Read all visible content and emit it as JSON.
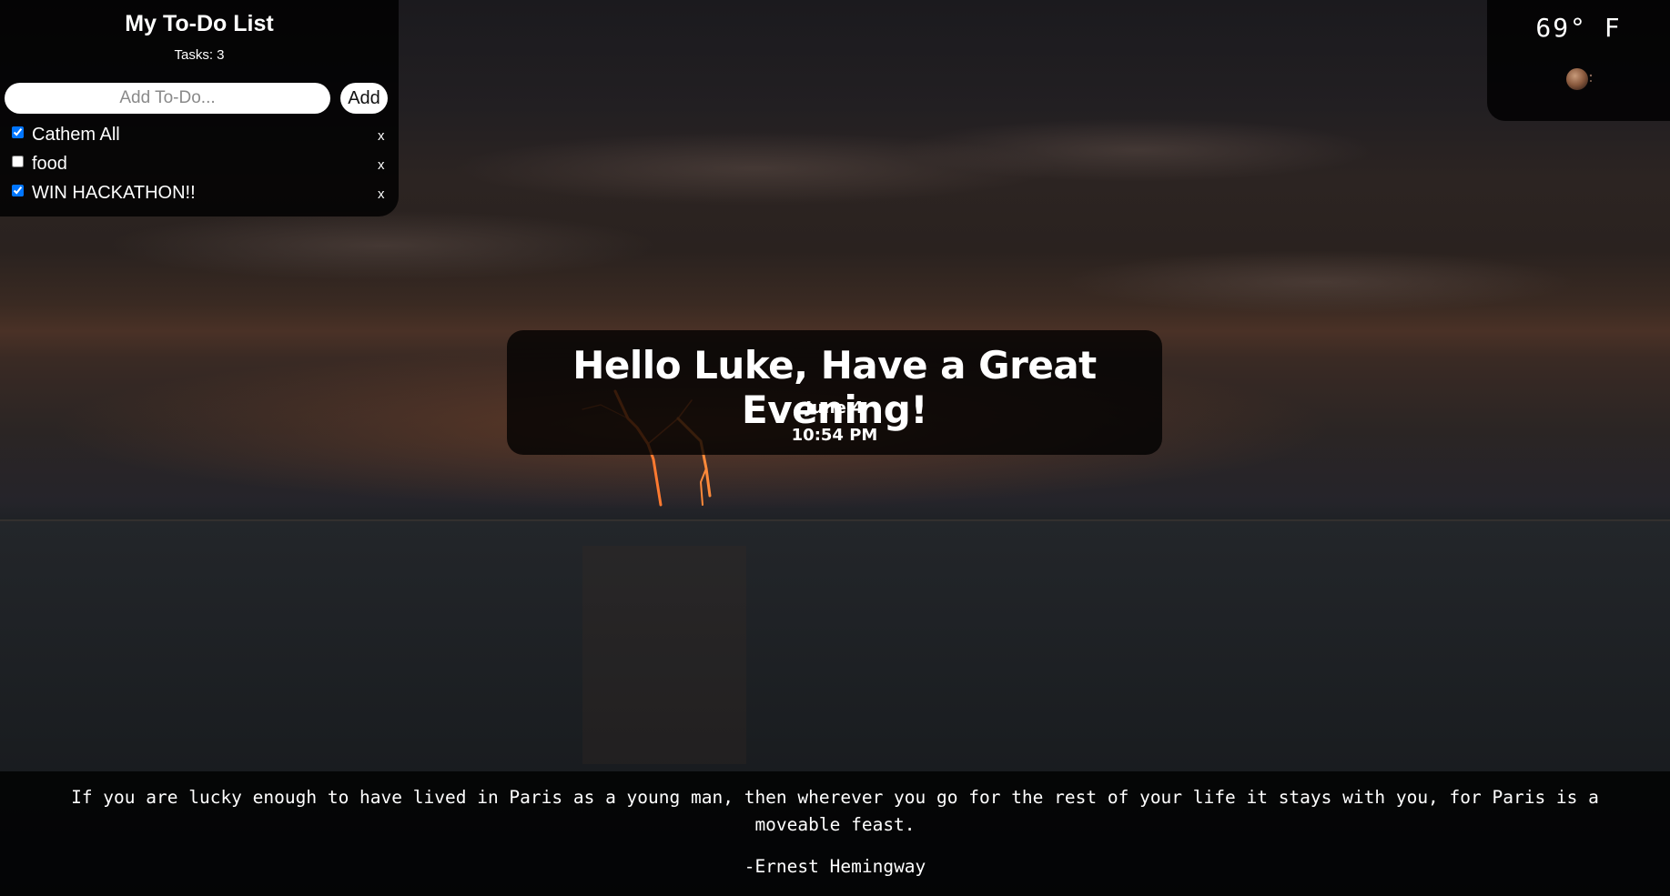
{
  "todo": {
    "title": "My To-Do List",
    "count_text": "Tasks: 3",
    "input_placeholder": "Add To-Do...",
    "add_label": "Add",
    "items": [
      {
        "label": "Cathem All",
        "checked": true,
        "delete_label": "x"
      },
      {
        "label": "food",
        "checked": false,
        "delete_label": "x"
      },
      {
        "label": "WIN HACKATHON!!",
        "checked": true,
        "delete_label": "x"
      }
    ]
  },
  "weather": {
    "temperature": "69° F",
    "icon": "moon-icon"
  },
  "greeting": {
    "message": "Hello Luke, Have a Great Evening!",
    "date": "June 4",
    "time": "10:54 PM"
  },
  "quote": {
    "text": "If you are lucky enough to have lived in Paris as a young man, then wherever you go for the rest of your life it stays with you, for Paris is a moveable feast.",
    "author": "-Ernest Hemingway"
  },
  "colors": {
    "panel": "#000000",
    "text": "#ffffff",
    "lightning": "#ff6a1f"
  }
}
